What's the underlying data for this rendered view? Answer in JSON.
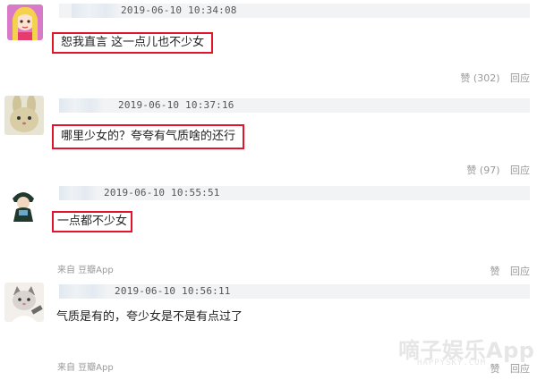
{
  "comments": [
    {
      "timestamp": "2019-06-10 10:34:08",
      "text": "恕我直言 这一点儿也不少女",
      "like_label": "赞",
      "like_count": "(302)",
      "reply_label": "回应",
      "avatar_icon": "anime-girl-avatar"
    },
    {
      "timestamp": "2019-06-10 10:37:16",
      "text": "哪里少女的？夸夸有气质啥的还行",
      "like_label": "赞",
      "like_count": "(97)",
      "reply_label": "回应",
      "avatar_icon": "rabbit-avatar"
    },
    {
      "timestamp": "2019-06-10 10:55:51",
      "text": "一点都不少女",
      "source": "来自 豆瓣App",
      "like_label": "赞",
      "like_count": "",
      "reply_label": "回应",
      "avatar_icon": "cartoon-character-avatar"
    },
    {
      "timestamp": "2019-06-10 10:56:11",
      "text": "气质是有的，夸少女是不是有点过了",
      "source": "来自 豆瓣App",
      "like_label": "赞",
      "like_count": "",
      "reply_label": "回应",
      "avatar_icon": "cat-avatar"
    }
  ],
  "watermark": {
    "title": "嘀子娱乐App",
    "subtitle": "HAPPYSKY.COM"
  },
  "colors": {
    "highlight_border": "#e0142b",
    "meta_bar": "#f1f3f5",
    "muted_text": "#999999"
  }
}
